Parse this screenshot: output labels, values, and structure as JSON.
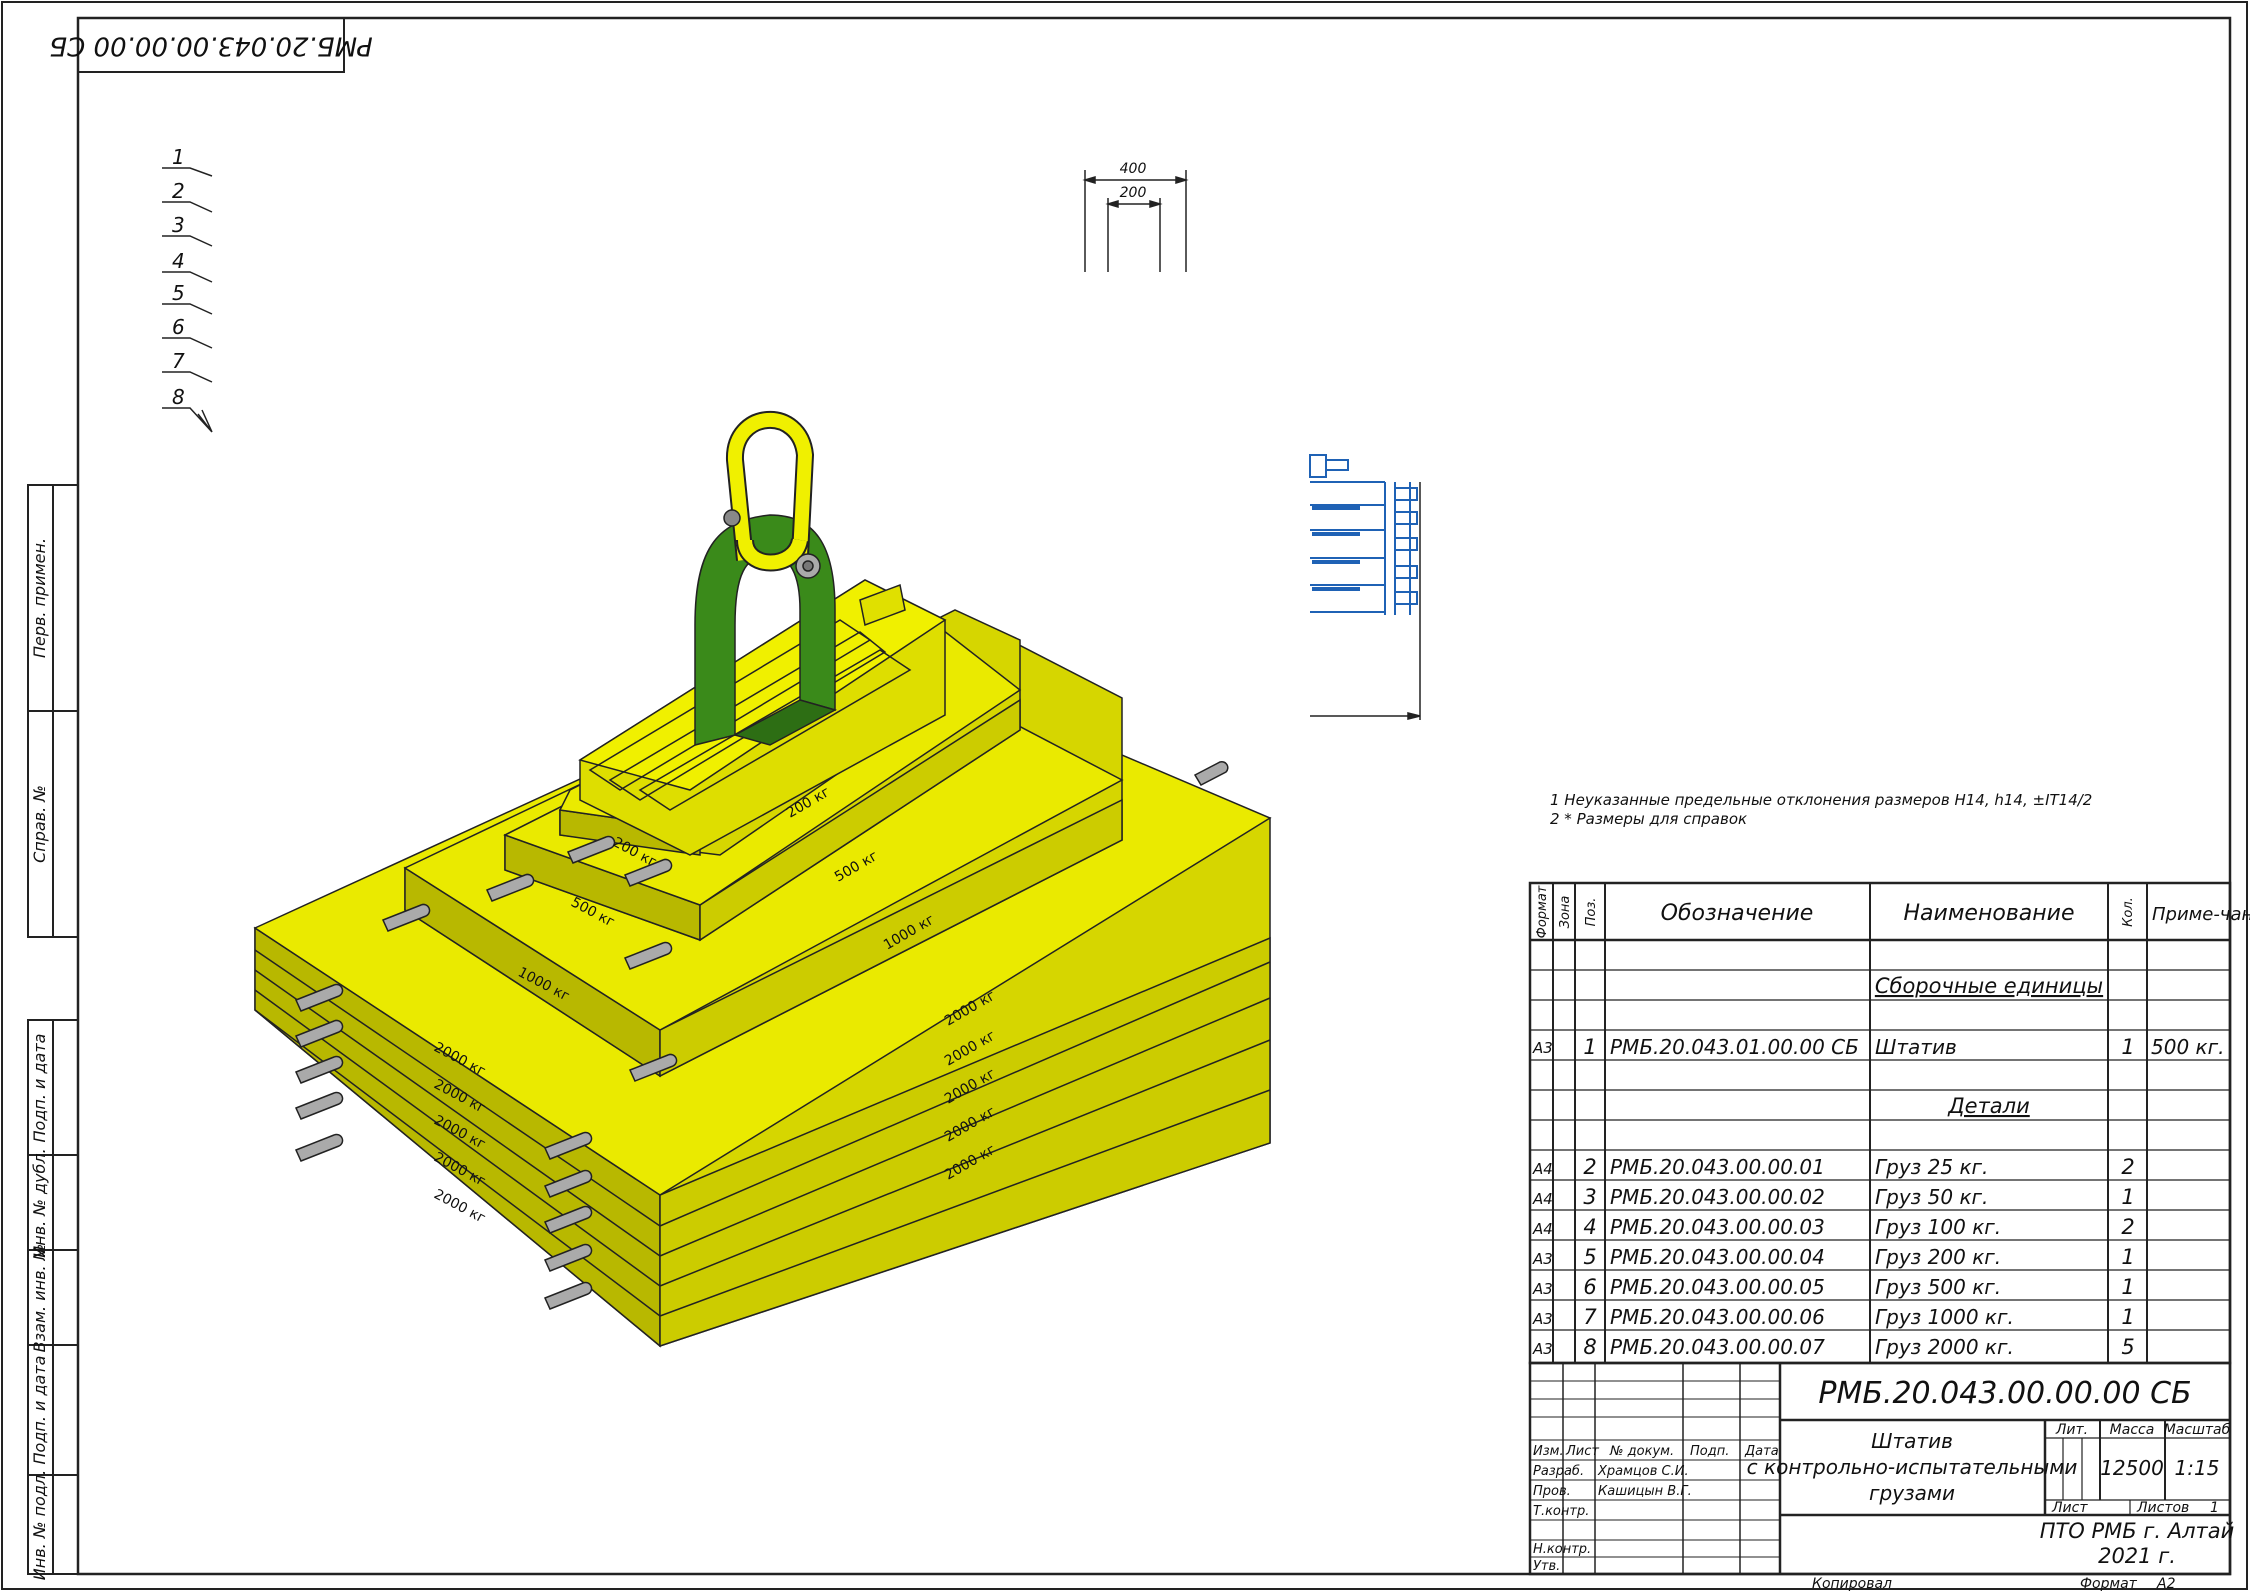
{
  "stamp_top": "РМБ.20.043.00.00.00 СБ",
  "side_labels": [
    "Перв. примен.",
    "Справ. №",
    "Подп. и дата",
    "Инв. № дубл.",
    "Взам. инв. №",
    "Подп. и дата",
    "Инв. № подл."
  ],
  "leader_numbers": [
    "1",
    "2",
    "3",
    "4",
    "5",
    "6",
    "7",
    "8"
  ],
  "dimensions": {
    "outer": "400",
    "inner": "200"
  },
  "load_marks": {
    "top_200": "200 кг",
    "left_200": "200 кг",
    "left_500": "500 кг",
    "right_500": "500 кг",
    "left_1000": "1000 кг",
    "right_1000": "1000 кг",
    "left_2000": [
      "2000 кг",
      "2000 кг",
      "2000 кг",
      "2000 кг",
      "2000 кг"
    ],
    "right_2000": [
      "2000 кг",
      "2000 кг",
      "2000 кг",
      "2000 кг",
      "2000 кг"
    ]
  },
  "notes": [
    "1  Неуказанные предельные отклонения размеров H14, h14, ±IT14/2",
    "2  * Размеры для справок"
  ],
  "spec": {
    "headers": {
      "format": "Формат",
      "zone": "Зона",
      "pos": "Поз.",
      "designation": "Обозначение",
      "name": "Наименование",
      "qty": "Кол.",
      "note": "Приме-чание"
    },
    "section_assembly": "Сборочные единицы",
    "section_parts": "Детали",
    "assembly_rows": [
      {
        "format": "А3",
        "pos": "1",
        "designation": "РМБ.20.043.01.00.00 СБ",
        "name": "Штатив",
        "qty": "1",
        "note": "500 кг."
      }
    ],
    "part_rows": [
      {
        "format": "А4",
        "pos": "2",
        "designation": "РМБ.20.043.00.00.01",
        "name": "Груз 25 кг.",
        "qty": "2"
      },
      {
        "format": "А4",
        "pos": "3",
        "designation": "РМБ.20.043.00.00.02",
        "name": "Груз 50 кг.",
        "qty": "1"
      },
      {
        "format": "А4",
        "pos": "4",
        "designation": "РМБ.20.043.00.00.03",
        "name": "Груз 100 кг.",
        "qty": "2"
      },
      {
        "format": "А3",
        "pos": "5",
        "designation": "РМБ.20.043.00.00.04",
        "name": "Груз 200 кг.",
        "qty": "1"
      },
      {
        "format": "А3",
        "pos": "6",
        "designation": "РМБ.20.043.00.00.05",
        "name": "Груз 500 кг.",
        "qty": "1"
      },
      {
        "format": "А3",
        "pos": "7",
        "designation": "РМБ.20.043.00.00.06",
        "name": "Груз 1000 кг.",
        "qty": "1"
      },
      {
        "format": "А3",
        "pos": "8",
        "designation": "РМБ.20.043.00.00.07",
        "name": "Груз 2000 кг.",
        "qty": "5"
      }
    ]
  },
  "title_block": {
    "code": "РМБ.20.043.00.00.00 СБ",
    "name_lines": [
      "Штатив",
      "с контрольно-испытательными",
      "грузами"
    ],
    "col_headers": [
      "Изм.",
      "Лист",
      "№ докум.",
      "Подп.",
      "Дата"
    ],
    "roles": [
      "Разраб.",
      "Пров.",
      "Т.контр.",
      "Н.контр.",
      "Утв."
    ],
    "people": [
      "Храмцов С.И.",
      "Кашицын В.Г."
    ],
    "lit_label": "Лит.",
    "mass_label": "Масса",
    "scale_label": "Масштаб",
    "mass": "12500",
    "scale": "1:15",
    "sheet_label": "Лист",
    "sheets_label": "Листов",
    "sheets": "1",
    "org_lines": [
      "ПТО РМБ г. Алтай",
      "2021 г."
    ],
    "copied": "Копировал",
    "format_label": "Формат",
    "format": "А2"
  },
  "colors": {
    "yellow": "#e8e800",
    "yellow_side": "#b8b800",
    "green": "#3a8a1a",
    "blue": "#1f62b5"
  }
}
